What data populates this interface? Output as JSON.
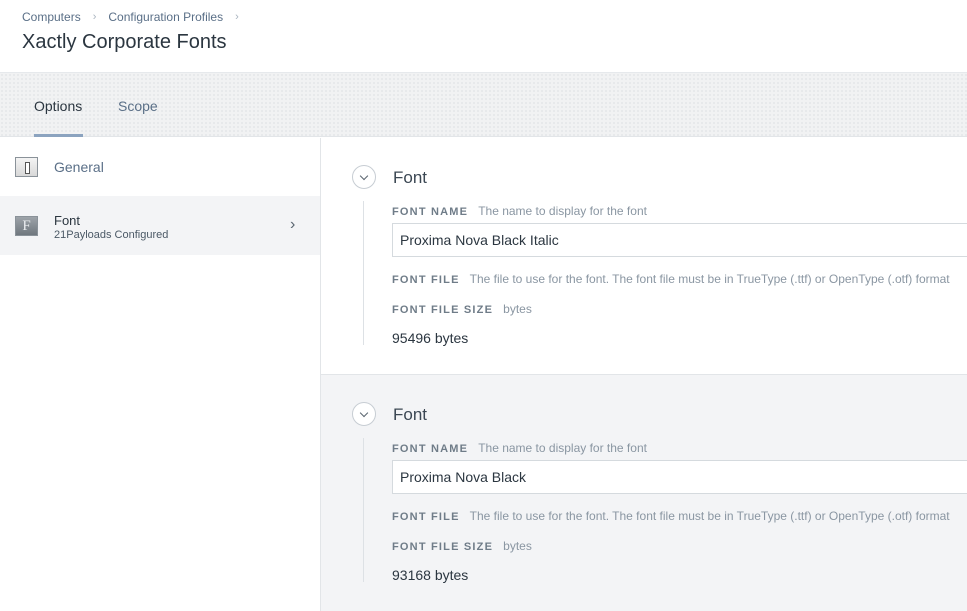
{
  "breadcrumb": {
    "items": [
      "Computers",
      "Configuration Profiles"
    ]
  },
  "page": {
    "title": "Xactly Corporate Fonts"
  },
  "tabs": [
    {
      "label": "Options"
    },
    {
      "label": "Scope"
    }
  ],
  "sidebar": {
    "items": [
      {
        "label": "General",
        "icon": "switch-icon"
      },
      {
        "label": "Font",
        "sublabel": "21Payloads Configured",
        "icon": "font-icon"
      }
    ]
  },
  "payloads": [
    {
      "title": "Font",
      "font_name_label": "FONT NAME",
      "font_name_help": "The name to display for the font",
      "font_name_value": "Proxima Nova Black Italic",
      "font_file_label": "FONT FILE",
      "font_file_help": "The file to use for the font. The font file must be in TrueType (.ttf) or OpenType (.otf) format",
      "font_file_size_label": "FONT FILE SIZE",
      "font_file_size_help": "bytes",
      "font_file_size_value": "95496 bytes"
    },
    {
      "title": "Font",
      "font_name_label": "FONT NAME",
      "font_name_help": "The name to display for the font",
      "font_name_value": "Proxima Nova Black",
      "font_file_label": "FONT FILE",
      "font_file_help": "The file to use for the font. The font file must be in TrueType (.ttf) or OpenType (.otf) format",
      "font_file_size_label": "FONT FILE SIZE",
      "font_file_size_help": "bytes",
      "font_file_size_value": "93168 bytes"
    }
  ]
}
